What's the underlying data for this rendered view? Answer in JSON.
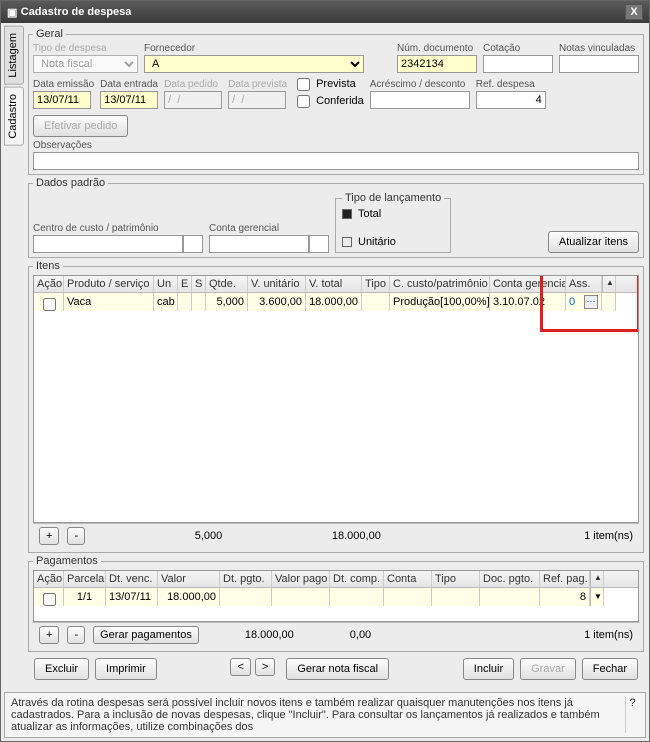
{
  "window": {
    "title": "Cadastro de despesa",
    "close": "X"
  },
  "tabs": {
    "listagem": "Listagem",
    "cadastro": "Cadastro"
  },
  "geral": {
    "legend": "Geral",
    "tipo_label": "Tipo de despesa",
    "tipo_value": "Nota fiscal",
    "fornecedor_label": "Fornecedor",
    "fornecedor_value": "A",
    "numdoc_label": "Núm. documento",
    "numdoc_value": "2342134",
    "cotacao_label": "Cotação",
    "notas_label": "Notas vinculadas",
    "emissao_label": "Data emissão",
    "emissao_value": "13/07/11",
    "entrada_label": "Data entrada",
    "entrada_value": "13/07/11",
    "pedido_label": "Data pedido",
    "pedido_value": "/  /",
    "prevista_label": "Data prevista",
    "prevista_value": "/  /",
    "chk_prevista": "Prevista",
    "chk_conferida": "Conferida",
    "acresc_label": "Acréscimo / desconto",
    "refdesp_label": "Ref. despesa",
    "refdesp_value": "4",
    "efetivar": "Efetivar pedido",
    "obs_label": "Observações"
  },
  "padrao": {
    "legend": "Dados padrão",
    "centro_label": "Centro de custo / patrimônio",
    "conta_label": "Conta gerencial",
    "tipolanc_label": "Tipo de lançamento",
    "total": "Total",
    "unitario": "Unitário",
    "atualizar": "Atualizar itens"
  },
  "itens": {
    "legend": "Itens",
    "cols": {
      "acao": "Ação",
      "prod": "Produto / serviço",
      "un": "Un",
      "e": "E",
      "s": "S",
      "qtde": "Qtde.",
      "vunit": "V. unitário",
      "vtotal": "V. total",
      "tipo": "Tipo",
      "ccusto": "C. custo/patrimônio",
      "cger": "Conta gerencial",
      "ass": "Ass."
    },
    "row": {
      "prod": "Vaca",
      "un": "cab",
      "qtde": "5,000",
      "vunit": "3.600,00",
      "vtotal": "18.000,00",
      "ccusto": "Produção[100,00%]",
      "cger": "3.10.07.02",
      "ass": "0"
    },
    "foot_qtde": "5,000",
    "foot_total": "18.000,00",
    "foot_count": "1  item(ns)",
    "plus": "+",
    "minus": "-"
  },
  "pag": {
    "legend": "Pagamentos",
    "cols": {
      "acao": "Ação",
      "parcela": "Parcela",
      "venc": "Dt. venc.",
      "valor": "Valor",
      "pgto": "Dt. pgto.",
      "valpago": "Valor pago",
      "comp": "Dt. comp.",
      "conta": "Conta",
      "tipo": "Tipo",
      "docpgto": "Doc. pgto.",
      "refpag": "Ref. pag."
    },
    "row": {
      "parcela": "1/1",
      "venc": "13/07/11",
      "valor": "18.000,00",
      "refpag": "8"
    },
    "gerar": "Gerar pagamentos",
    "foot_valor": "18.000,00",
    "foot_pago": "0,00",
    "foot_count": "1  item(ns)"
  },
  "buttons": {
    "excluir": "Excluir",
    "imprimir": "Imprimir",
    "prev": "<",
    "next": ">",
    "gerarnota": "Gerar nota fiscal",
    "incluir": "Incluir",
    "gravar": "Gravar",
    "fechar": "Fechar"
  },
  "hint": "Através da rotina despesas será possível incluir novos itens e também realizar quaisquer manutenções nos itens já cadastrados. Para a inclusão de novas despesas, clique \"Incluir\". Para consultar os lançamentos já realizados e também atualizar as informações, utilize combinações dos",
  "hint_q": "?"
}
